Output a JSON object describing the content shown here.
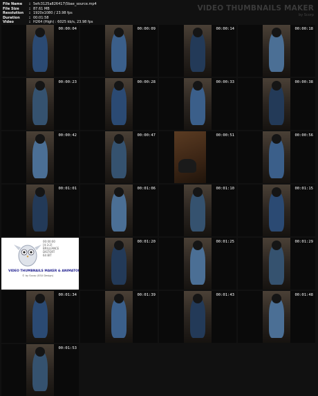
{
  "info": [
    {
      "key": "File Name",
      "value": "5efc3125a826417\\5bae_source.mp4"
    },
    {
      "key": "File Size",
      "value": "87.61 MB"
    },
    {
      "key": "Resolution",
      "value": "1920x1080 / 23.98 fps"
    },
    {
      "key": "Duration",
      "value": "00:01:58"
    },
    {
      "key": "Video",
      "value": "H264 (High) : 6025 kb/s, 23.98 fps"
    }
  ],
  "brand": {
    "title": "VIDEO THUMBNAILS MAKER",
    "subtitle": "by Scorp"
  },
  "logo": {
    "title": "VIDEO THUMBNAILS MAKER & ANIMATOR",
    "subtitle": "© by Scorp (SSU Design)",
    "side": [
      "00:00:00",
      "[4:3:2]",
      "BRILLIANCE",
      "DISTORT",
      "64 BIT"
    ]
  },
  "thumbnails": [
    {
      "time": "00:00:04",
      "scene": "vertical"
    },
    {
      "time": "00:00:09",
      "scene": "vertical"
    },
    {
      "time": "00:00:14",
      "scene": "vertical"
    },
    {
      "time": "00:00:18",
      "scene": "vertical"
    },
    {
      "time": "00:00:23",
      "scene": "vertical"
    },
    {
      "time": "00:00:28",
      "scene": "vertical"
    },
    {
      "time": "00:00:33",
      "scene": "vertical"
    },
    {
      "time": "00:00:38",
      "scene": "vertical"
    },
    {
      "time": "00:00:42",
      "scene": "vertical"
    },
    {
      "time": "00:00:47",
      "scene": "vertical"
    },
    {
      "time": "00:00:51",
      "scene": "floor"
    },
    {
      "time": "00:00:56",
      "scene": "vertical"
    },
    {
      "time": "00:01:01",
      "scene": "vertical"
    },
    {
      "time": "00:01:06",
      "scene": "vertical"
    },
    {
      "time": "00:01:10",
      "scene": "vertical"
    },
    {
      "time": "00:01:15",
      "scene": "vertical"
    },
    {
      "time": "",
      "scene": "logo"
    },
    {
      "time": "00:01:20",
      "scene": "vertical"
    },
    {
      "time": "00:01:25",
      "scene": "vertical"
    },
    {
      "time": "00:01:29",
      "scene": "vertical"
    },
    {
      "time": "00:01:34",
      "scene": "vertical"
    },
    {
      "time": "00:01:39",
      "scene": "vertical"
    },
    {
      "time": "00:01:43",
      "scene": "vertical"
    },
    {
      "time": "00:01:48",
      "scene": "vertical"
    },
    {
      "time": "00:01:53",
      "scene": "vertical"
    }
  ]
}
